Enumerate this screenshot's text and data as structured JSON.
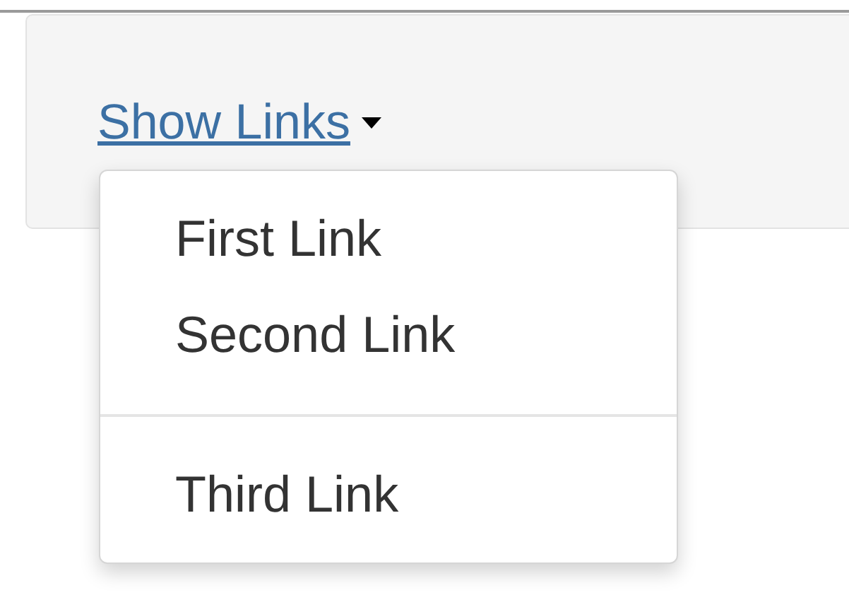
{
  "toggle": {
    "label": "Show Links",
    "expanded": true
  },
  "menu": {
    "items": [
      {
        "kind": "link",
        "label": "First Link"
      },
      {
        "kind": "link",
        "label": "Second Link"
      },
      {
        "kind": "divider"
      },
      {
        "kind": "link",
        "label": "Third Link"
      }
    ]
  }
}
